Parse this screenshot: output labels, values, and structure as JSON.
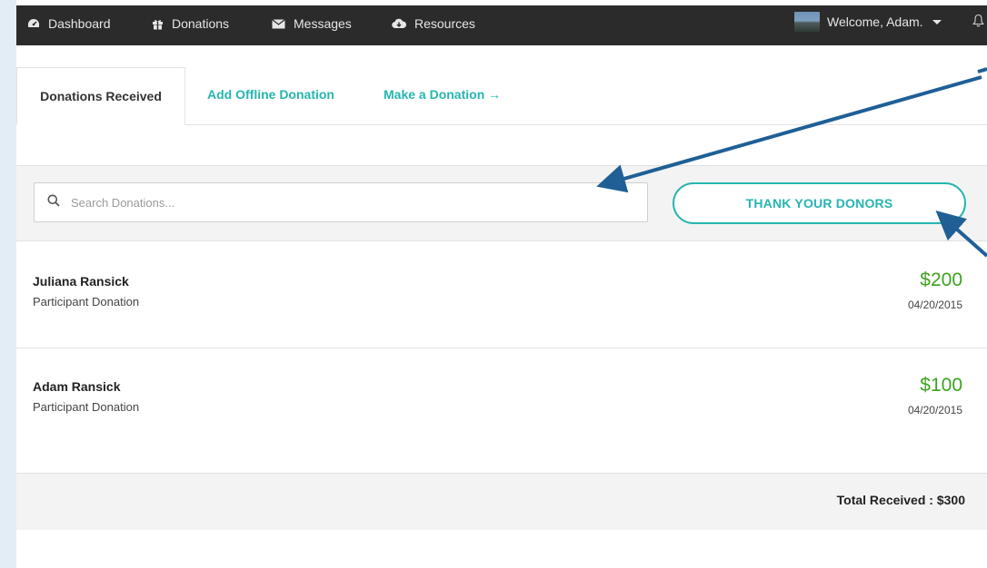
{
  "nav": {
    "items": [
      {
        "label": "Dashboard",
        "icon": "dashboard-icon"
      },
      {
        "label": "Donations",
        "icon": "gift-icon"
      },
      {
        "label": "Messages",
        "icon": "envelope-icon"
      },
      {
        "label": "Resources",
        "icon": "cloud-download-icon"
      }
    ],
    "welcome": "Welcome, Adam."
  },
  "tabs": {
    "active": "Donations Received",
    "offline": "Add Offline Donation",
    "make": "Make a Donation →"
  },
  "search": {
    "placeholder": "Search Donations..."
  },
  "thank_button": "THANK YOUR DONORS",
  "donations": [
    {
      "name": "Juliana Ransick",
      "type": "Participant Donation",
      "amount": "$200",
      "date": "04/20/2015"
    },
    {
      "name": "Adam Ransick",
      "type": "Participant Donation",
      "amount": "$100",
      "date": "04/20/2015"
    }
  ],
  "total": "Total Received : $300",
  "colors": {
    "accent": "#26b5b0",
    "amount": "#3da31f",
    "nav_bg": "#2b2b2b",
    "annotation": "#1f5f96"
  }
}
